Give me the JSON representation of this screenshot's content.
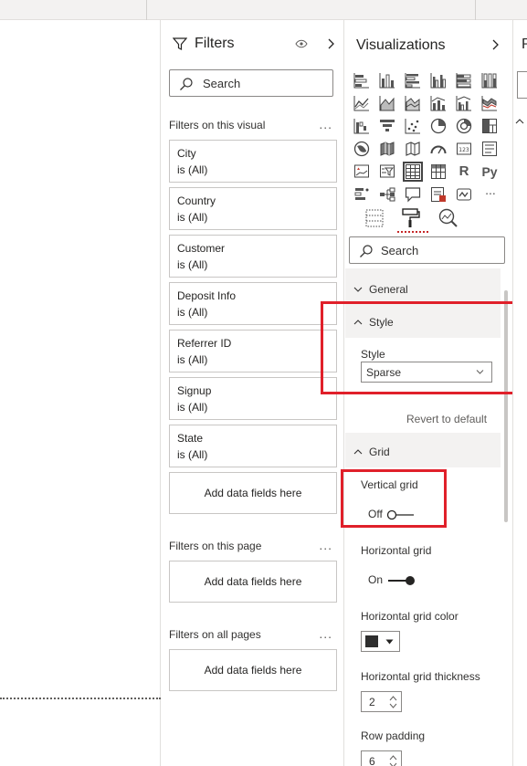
{
  "filters_pane": {
    "title": "Filters",
    "search_placeholder": "Search",
    "section_visual": "Filters on this visual",
    "section_page": "Filters on this page",
    "section_all": "Filters on all pages",
    "more_label": "...",
    "cards": [
      {
        "name": "City",
        "state": "is (All)"
      },
      {
        "name": "Country",
        "state": "is (All)"
      },
      {
        "name": "Customer",
        "state": "is (All)"
      },
      {
        "name": "Deposit Info",
        "state": "is (All)"
      },
      {
        "name": "Referrer ID",
        "state": "is (All)"
      },
      {
        "name": "Signup",
        "state": "is (All)"
      },
      {
        "name": "State",
        "state": "is (All)"
      }
    ],
    "add_fields_label": "Add data fields here"
  },
  "viz_pane": {
    "title": "Visualizations",
    "text_icons": {
      "r": "R",
      "py": "Py",
      "more": "..."
    },
    "search_placeholder": "Search",
    "general_label": "General",
    "style_card": {
      "title": "Style",
      "field_label": "Style",
      "selected": "Sparse"
    },
    "revert_label": "Revert to default",
    "grid_card": {
      "title": "Grid",
      "vertical_grid": {
        "label": "Vertical grid",
        "state": "Off"
      },
      "horizontal_grid": {
        "label": "Horizontal grid",
        "state": "On"
      },
      "horizontal_grid_color": {
        "label": "Horizontal grid color",
        "value": "#2e2e2e"
      },
      "horizontal_grid_thickness": {
        "label": "Horizontal grid thickness",
        "value": "2"
      },
      "row_padding": {
        "label": "Row padding",
        "value": "6"
      }
    }
  },
  "right_pane": {
    "title_initial": "P"
  },
  "colors": {
    "highlight": "#e0202a",
    "accent_underline": "#c62828",
    "toggle_on": "#252423"
  }
}
